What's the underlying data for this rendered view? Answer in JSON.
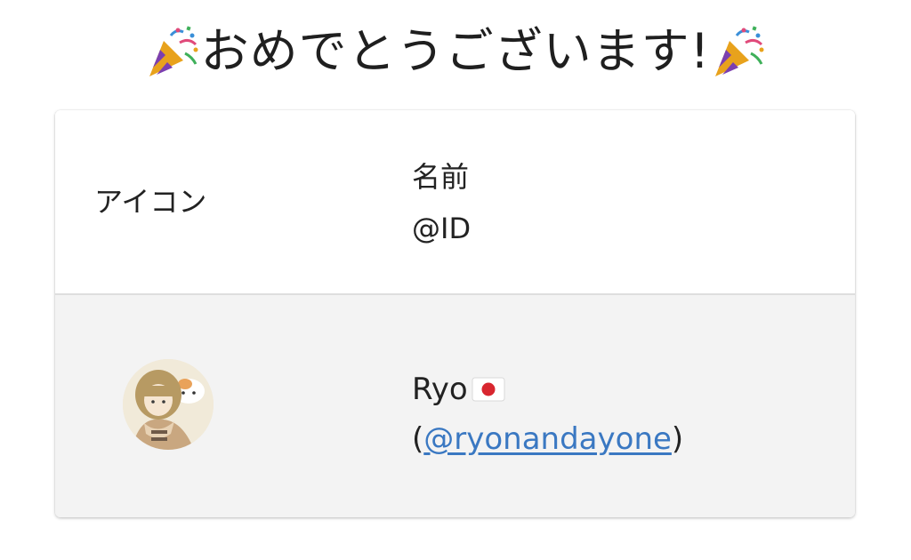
{
  "title": {
    "text": "おめでとうございます!",
    "emoji": "party-popper-icon"
  },
  "table": {
    "headers": {
      "icon": "アイコン",
      "name": "名前",
      "id": "@ID"
    },
    "rows": [
      {
        "avatar": "avatar",
        "name": "Ryo",
        "flag": "japan-flag-icon",
        "id_open": "(",
        "id_link": "@ryonandayone",
        "id_close": ")"
      }
    ]
  },
  "colors": {
    "row_bg": "#f3f3f3",
    "link": "#3a78c2",
    "divider": "#dedede"
  }
}
